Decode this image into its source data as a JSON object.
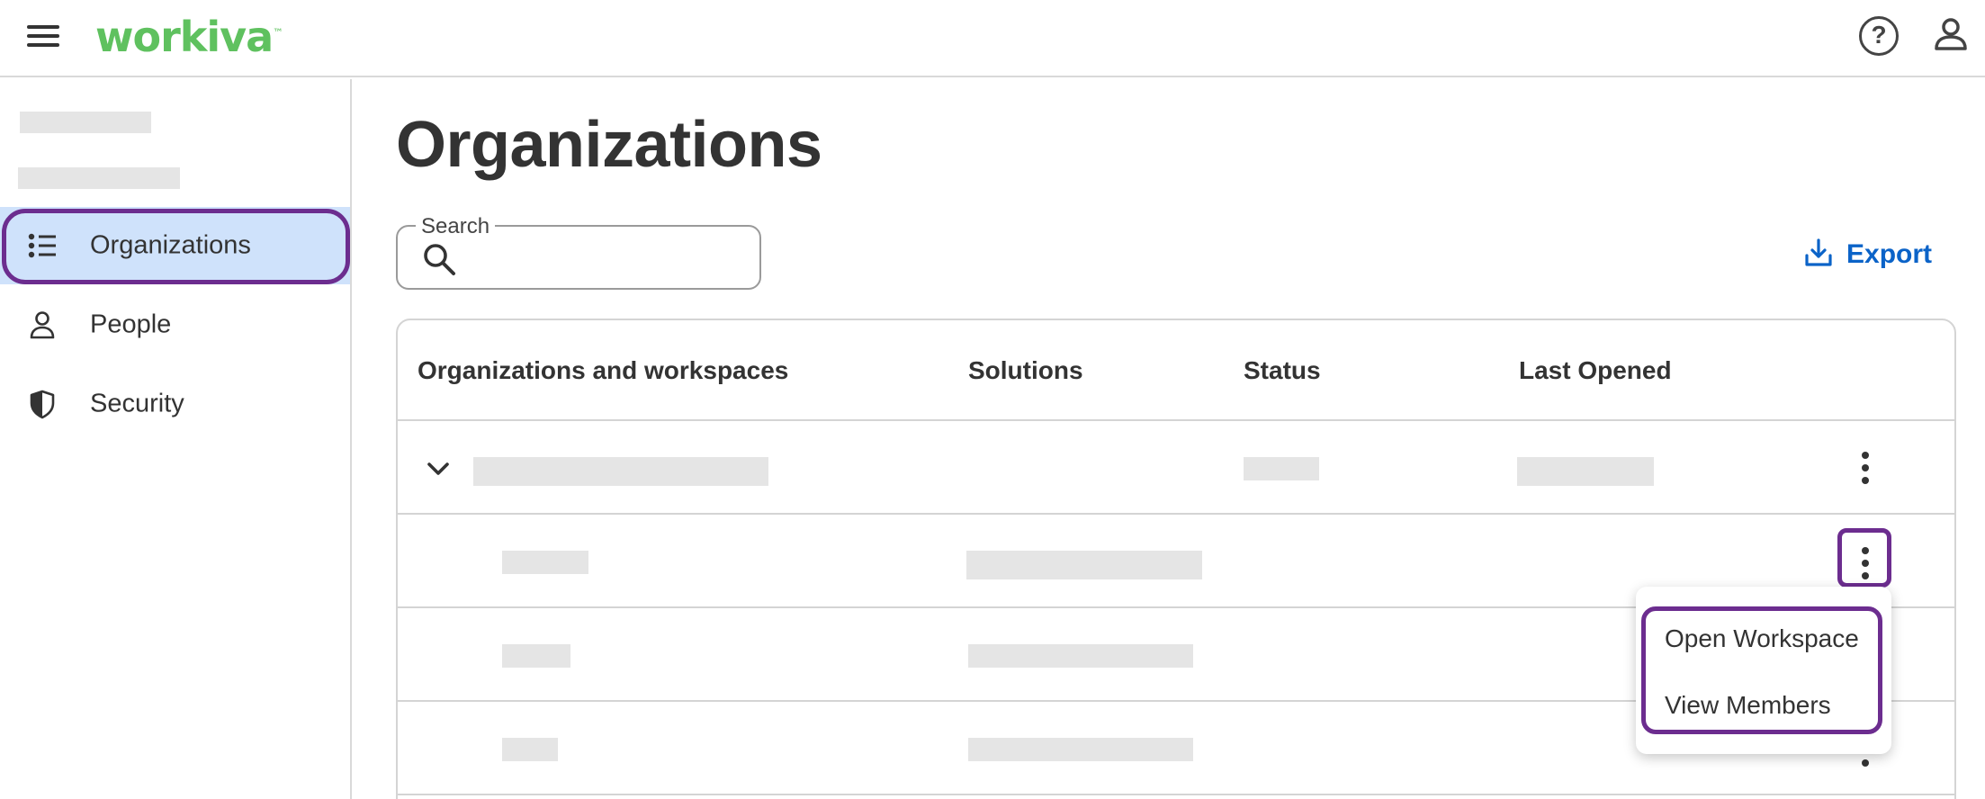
{
  "app": {
    "brand": "workiva",
    "brand_tm": "™"
  },
  "topbar": {
    "help_glyph": "?",
    "icons": [
      "menu-icon",
      "help-icon",
      "user-icon"
    ]
  },
  "sidebar": {
    "items": [
      {
        "label": "Organizations",
        "icon": "list-icon",
        "active": true
      },
      {
        "label": "People",
        "icon": "person-icon",
        "active": false
      },
      {
        "label": "Security",
        "icon": "shield-icon",
        "active": false
      }
    ]
  },
  "main": {
    "title": "Organizations",
    "search": {
      "legend": "Search",
      "value": "",
      "placeholder": ""
    },
    "export_label": "Export"
  },
  "table": {
    "columns": [
      "Organizations and workspaces",
      "Solutions",
      "Status",
      "Last Opened"
    ]
  },
  "menu": {
    "items": [
      "Open Workspace",
      "View Members"
    ]
  },
  "colors": {
    "brand": "#5fc15f",
    "accent": "#0b63c8",
    "active_bg": "#cfe2fb",
    "highlight": "#6c2d8f",
    "skeleton": "#e5e5e5"
  }
}
